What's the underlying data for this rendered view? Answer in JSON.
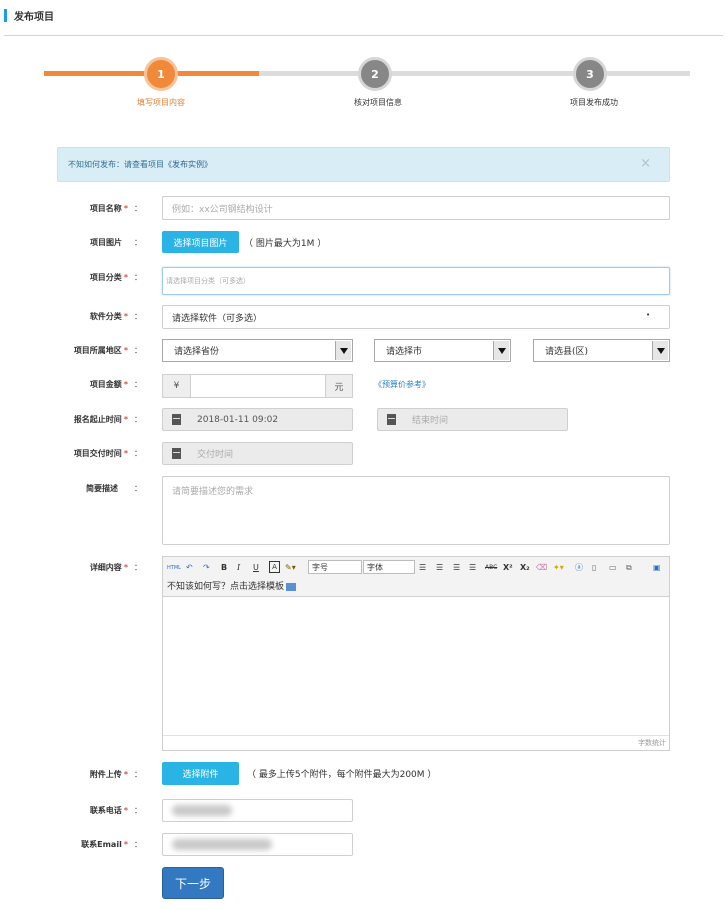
{
  "page": {
    "title": "发布项目"
  },
  "steps": [
    {
      "number": "1",
      "label": "填写项目内容",
      "active": true
    },
    {
      "number": "2",
      "label": "核对项目信息",
      "active": false
    },
    {
      "number": "3",
      "label": "项目发布成功",
      "active": false
    }
  ],
  "alert": {
    "text": "不知如何发布：请查看项目",
    "link": "《发布实例》",
    "close": "×"
  },
  "form": {
    "name": {
      "label": "项目名称",
      "required": "*",
      "placeholder": "例如：xx公司钢结构设计"
    },
    "image": {
      "label": "项目图片",
      "button": "选择项目图片",
      "hint": "（ 图片最大为1M ）"
    },
    "category": {
      "label": "项目分类",
      "required": "*",
      "placeholder": "请选择项目分类（可多选）"
    },
    "software": {
      "label": "软件分类",
      "required": "*",
      "value": "请选择软件（可多选）",
      "dot": "•"
    },
    "region": {
      "label": "项目所属地区",
      "required": "*",
      "province": "请选择省份",
      "city": "请选择市",
      "county": "请选县(区)"
    },
    "amount": {
      "label": "项目金额",
      "required": "*",
      "prefix": "¥",
      "suffix": "元",
      "link": "《预算价参考》"
    },
    "signup_time": {
      "label": "报名起止时间",
      "required": "*",
      "start": "2018-01-11 09:02",
      "end_placeholder": "结束时间"
    },
    "delivery_time": {
      "label": "项目交付时间",
      "required": "*",
      "placeholder": "交付时间"
    },
    "summary": {
      "label": "简要描述",
      "placeholder": "请简要描述您的需求"
    },
    "detail": {
      "label": "详细内容",
      "required": "*",
      "font_size": "字号",
      "font_family": "字体",
      "template_hint": "不知该如何写？点击选择模板",
      "word_count": "字数统计"
    },
    "attachment": {
      "label": "附件上传",
      "required": "*",
      "button": "选择附件",
      "hint": "（ 最多上传5个附件，每个附件最大为200M ）"
    },
    "phone": {
      "label": "联系电话",
      "required": "*"
    },
    "email": {
      "label": "联系Email",
      "required": "*"
    },
    "colon": "：",
    "submit": "下一步"
  },
  "colors": {
    "accent": "#f08a3a",
    "primary": "#2ab4e6",
    "submit": "#3379c2"
  }
}
